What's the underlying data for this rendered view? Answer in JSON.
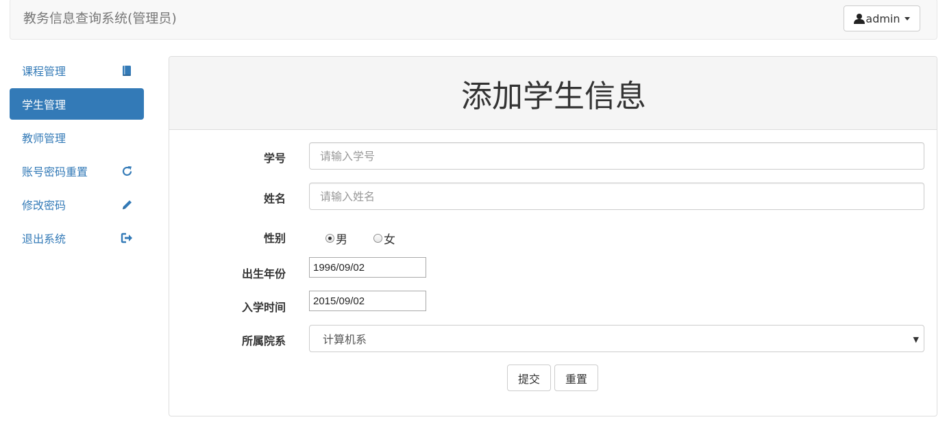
{
  "navbar": {
    "brand": "教务信息查询系统(管理员)",
    "user_label": "admin",
    "user_icon": "user-icon"
  },
  "sidebar": {
    "items": [
      {
        "label": "课程管理",
        "icon": "book-icon",
        "active": false
      },
      {
        "label": "学生管理",
        "icon": "",
        "active": true
      },
      {
        "label": "教师管理",
        "icon": "",
        "active": false
      },
      {
        "label": "账号密码重置",
        "icon": "refresh-icon",
        "active": false
      },
      {
        "label": "修改密码",
        "icon": "pencil-icon",
        "active": false
      },
      {
        "label": "退出系统",
        "icon": "logout-icon",
        "active": false
      }
    ]
  },
  "form": {
    "title": "添加学生信息",
    "student_id": {
      "label": "学号",
      "placeholder": "请输入学号",
      "value": ""
    },
    "name": {
      "label": "姓名",
      "placeholder": "请输入姓名",
      "value": ""
    },
    "gender": {
      "label": "性别",
      "options": [
        "男",
        "女"
      ],
      "selected": "男"
    },
    "birth": {
      "label": "出生年份",
      "value": "1996/09/02"
    },
    "enroll": {
      "label": "入学时间",
      "value": "2015/09/02"
    },
    "department": {
      "label": "所属院系",
      "value": "计算机系"
    },
    "submit_label": "提交",
    "reset_label": "重置"
  },
  "colors": {
    "primary": "#337ab7",
    "navbar_bg": "#f8f8f8",
    "panel_heading_bg": "#f5f5f5"
  }
}
